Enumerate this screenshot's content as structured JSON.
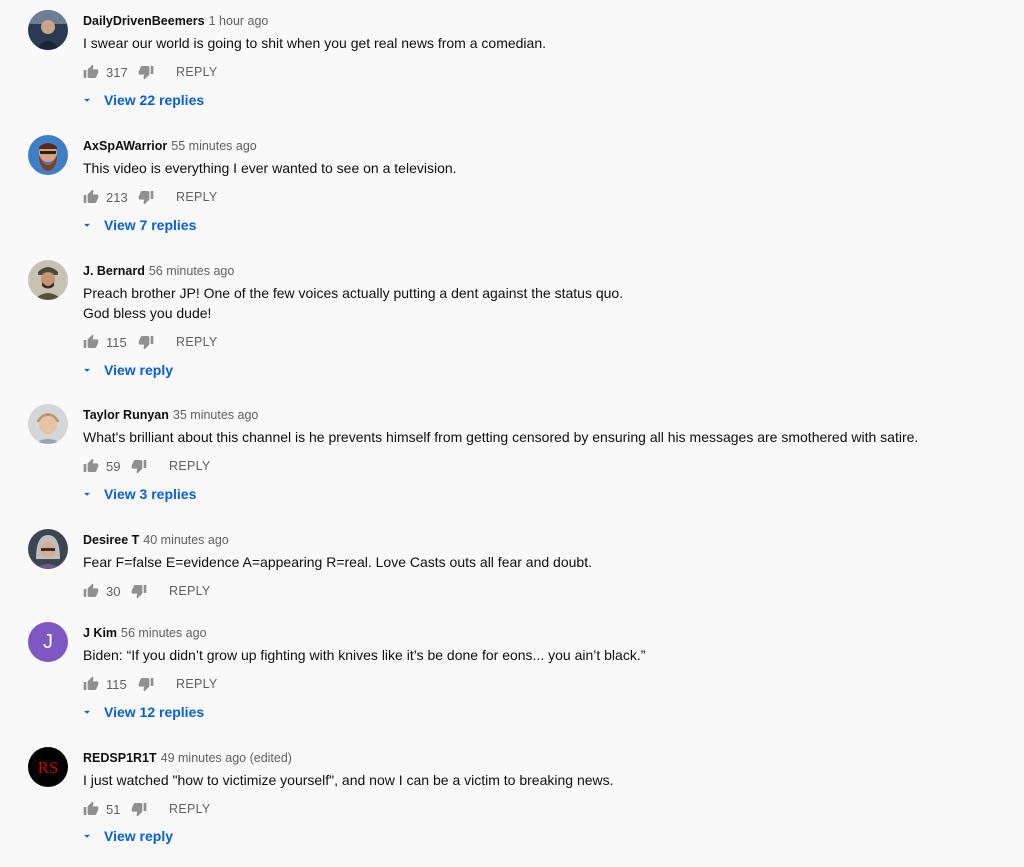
{
  "comments": [
    {
      "author": "DailyDrivenBeemers",
      "time": "1 hour ago",
      "text": "I swear our world is going to shit when you get real news from a comedian.",
      "likes": "317",
      "reply_label": "REPLY",
      "view_replies": "View 22 replies"
    },
    {
      "author": "AxSpAWarrior",
      "time": "55 minutes ago",
      "text": "This video is everything I ever wanted to see on a television.",
      "likes": "213",
      "reply_label": "REPLY",
      "view_replies": "View 7 replies"
    },
    {
      "author": "J. Bernard",
      "time": "56 minutes ago",
      "text": "Preach brother JP! One of the few voices actually putting a dent against the status quo.\nGod bless you dude!",
      "likes": "115",
      "reply_label": "REPLY",
      "view_replies": "View reply"
    },
    {
      "author": "Taylor Runyan",
      "time": "35 minutes ago",
      "text": "What's brilliant about this channel is he prevents himself from getting censored by ensuring all his messages are smothered with satire.",
      "likes": "59",
      "reply_label": "REPLY",
      "view_replies": "View 3 replies"
    },
    {
      "author": "Desiree T",
      "time": "40 minutes ago",
      "text": "Fear F=false E=evidence A=appearing R=real. Love Casts outs all fear and doubt.",
      "likes": "30",
      "reply_label": "REPLY"
    },
    {
      "author": "J Kim",
      "time": "56 minutes ago",
      "text": "Biden: “If you didn’t grow up fighting with knives like it’s be done for eons... you ain’t black.”",
      "likes": "115",
      "reply_label": "REPLY",
      "view_replies": "View 12 replies",
      "avatar_letter": "J"
    },
    {
      "author": "REDSP1R1T",
      "time": "49 minutes ago (edited)",
      "text": "I just watched \"how to victimize yourself\", and now I can be a victim to breaking news.",
      "likes": "51",
      "reply_label": "REPLY",
      "view_replies": "View reply",
      "avatar_logo_text": "RS"
    }
  ],
  "colors": {
    "background": "#f9f9f9",
    "link_blue": "#065fd4",
    "secondary_text": "#606060",
    "jkim_avatar": "#7e57c2",
    "redspirit_logo": "#cc0000"
  },
  "icons": {
    "like": "thumb-up-icon",
    "dislike": "thumb-down-icon",
    "expand": "caret-down-icon"
  }
}
